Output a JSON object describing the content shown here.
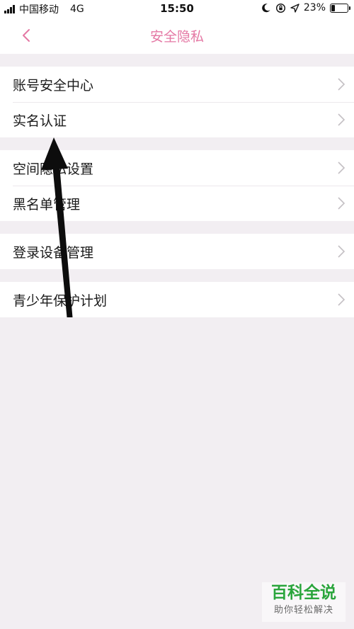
{
  "status_bar": {
    "carrier": "中国移动",
    "network": "4G",
    "time": "15:50",
    "battery": "23%"
  },
  "header": {
    "title": "安全隐私"
  },
  "menu_groups": [
    {
      "items": [
        {
          "label": "账号安全中心"
        },
        {
          "label": "实名认证"
        }
      ]
    },
    {
      "items": [
        {
          "label": "空间隐私设置"
        },
        {
          "label": "黑名单管理"
        }
      ]
    },
    {
      "items": [
        {
          "label": "登录设备管理"
        }
      ]
    },
    {
      "items": [
        {
          "label": "青少年保护计划"
        }
      ]
    }
  ],
  "watermark": {
    "title": "百科全说",
    "subtitle": "助你轻松解决"
  },
  "colors": {
    "accent": "#e478a4",
    "background": "#f2eef2",
    "watermark_green": "#2aa53c"
  }
}
